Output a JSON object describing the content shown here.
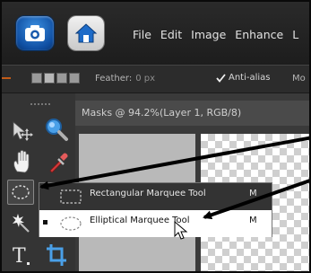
{
  "menu": {
    "items": [
      "File",
      "Edit",
      "Image",
      "Enhance",
      "L"
    ]
  },
  "options_bar": {
    "feather_label": "Feather:",
    "feather_value": "0 px",
    "antialias_label": "Anti-alias",
    "antialias_checked": true,
    "mode_label": "Mo"
  },
  "document": {
    "tab_title": "Masks @ 94.2%(Layer 1, RGB/8)"
  },
  "flyout": {
    "items": [
      {
        "label": "Rectangular Marquee Tool",
        "shortcut": "M",
        "icon": "rectangular-marquee-icon",
        "selected": false
      },
      {
        "label": "Elliptical Marquee Tool",
        "shortcut": "M",
        "icon": "elliptical-marquee-icon",
        "selected": true
      }
    ]
  },
  "colors": {
    "menubar": "#1d1d1d",
    "app_button": "#1a63c0",
    "flyout_highlight": "#333333",
    "arrow": "#000000"
  },
  "toolbox": {
    "tools": [
      "move-tool-icon",
      "zoom-tool-icon",
      "hand-tool-icon",
      "eyedropper-tool-icon",
      "marquee-tool-icon",
      "magic-wand-tool-icon",
      "type-tool-icon",
      "crop-tool-icon"
    ]
  }
}
